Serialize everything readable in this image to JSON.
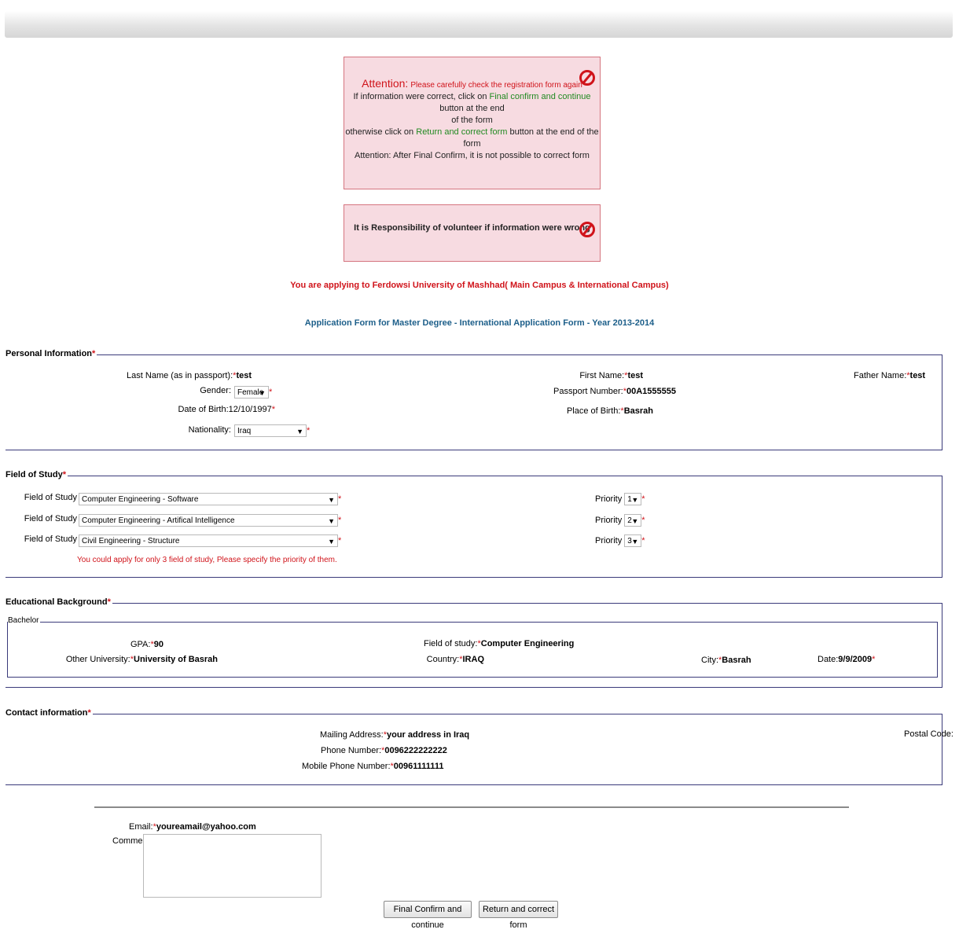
{
  "attention": {
    "head": "Attention:",
    "head_msg": "Please carefully check the registration form again",
    "line2_a": "If information were correct, click on",
    "line2_link": "Final confirm and continue",
    "line2_b": "button at the end",
    "line3": "of the form",
    "line4_a": "otherwise click on",
    "line4_link": "Return and correct form",
    "line4_b": "button at the end of the form",
    "line5": "Attention: After Final Confirm, it is not possible to correct form"
  },
  "responsibility": "It is Responsibility of volunteer if information were wrong",
  "applying": "You are applying to Ferdowsi University of Mashhad( Main Campus & International Campus)",
  "form_title": "Application Form for Master Degree - International Application Form - Year 2013-2014",
  "personal": {
    "legend": "Personal Information",
    "last_name_label": "Last Name (as in passport):",
    "last_name": "test",
    "first_name_label": "First Name:",
    "first_name": "test",
    "father_name_label": "Father Name:",
    "father_name": "test",
    "gender_label": "Gender:",
    "gender": "Female",
    "passport_label": "Passport Number:",
    "passport": "00A1555555",
    "dob_label": "Date of Birth:",
    "dob": "12/10/1997",
    "pob_label": "Place of Birth:",
    "pob": "Basrah",
    "nationality_label": "Nationality:",
    "nationality": "Iraq"
  },
  "study": {
    "legend": "Field of Study",
    "field_label": "Field of Study",
    "priority_label": "Priority",
    "rows": [
      {
        "field": "Computer Engineering - Software",
        "priority": "1"
      },
      {
        "field": "Computer Engineering - Artifical Intelligence",
        "priority": "2"
      },
      {
        "field": "Civil Engineering - Structure",
        "priority": "3"
      }
    ],
    "note": "You could apply for only 3 field of study, Please specify the priority of them."
  },
  "education": {
    "legend": "Educational Background",
    "sub_legend": "Bachelor",
    "gpa_label": "GPA:",
    "gpa": "90",
    "fos_label": "Field of study:",
    "fos": "Computer Engineering",
    "uni_label": "Other University:",
    "uni": "University of Basrah",
    "country_label": "Country:",
    "country": "IRAQ",
    "city_label": "City:",
    "city": "Basrah",
    "date_label": "Date:",
    "date": "9/9/2009"
  },
  "contact": {
    "legend": "Contact information",
    "mail_label": "Mailing Address:",
    "mail": "your address in Iraq",
    "phone_label": "Phone Number:",
    "phone": "0096222222222",
    "mobile_label": "Mobile Phone Number:",
    "mobile": "00961111111",
    "postal_label": "Postal Code:"
  },
  "email_label": "Email:",
  "email": "youreamail@yahoo.com",
  "comments_label": "Comments:",
  "buttons": {
    "confirm": "Final Confirm and continue",
    "return": "Return and correct form"
  },
  "required_mark": "*"
}
